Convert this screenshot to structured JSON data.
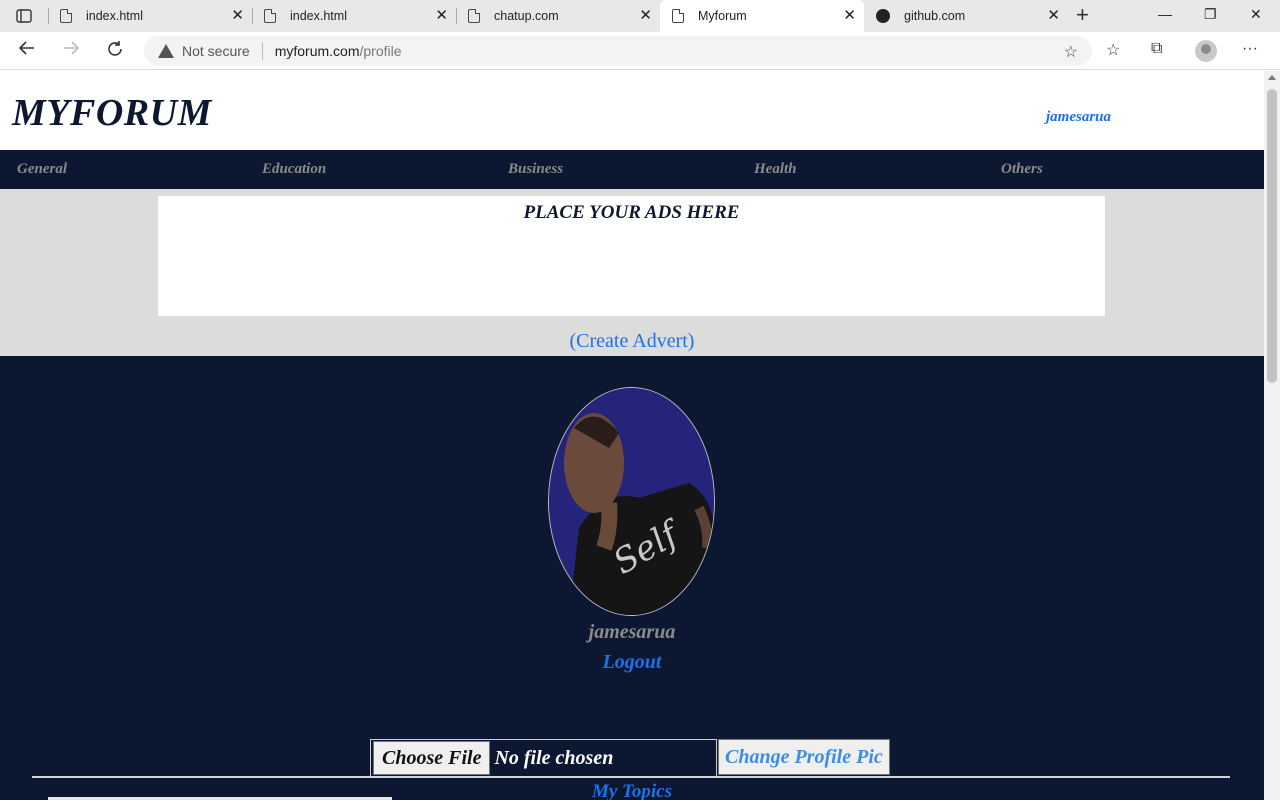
{
  "browser": {
    "tabs": [
      {
        "title": "index.html",
        "icon": "document-icon"
      },
      {
        "title": "index.html",
        "icon": "document-icon"
      },
      {
        "title": "chatup.com",
        "icon": "document-icon"
      },
      {
        "title": "Myforum",
        "icon": "document-icon",
        "active": true
      },
      {
        "title": "github.com",
        "icon": "github-icon"
      }
    ],
    "security_label": "Not secure",
    "url_host": "myforum.com",
    "url_path": "/profile"
  },
  "site": {
    "logo": "MYFORUM",
    "username": "jamesarua"
  },
  "nav": {
    "categories": [
      "General",
      "Education",
      "Business",
      "Health",
      "Others"
    ]
  },
  "ads": {
    "title": "PLACE YOUR ADS HERE",
    "create_link": "(Create Advert)"
  },
  "profile": {
    "name": "jamesarua",
    "logout": "Logout",
    "photo_shirt_text": "Self",
    "choose_file": "Choose File",
    "file_status": "No file chosen",
    "change_pic": "Change Profile Pic",
    "topics_heading": "My Topics"
  },
  "colors": {
    "navy": "#0c1731",
    "link_blue": "#1a73e8",
    "muted_gray": "#8b8b8b",
    "ad_zone_gray": "#dcdcdc"
  }
}
